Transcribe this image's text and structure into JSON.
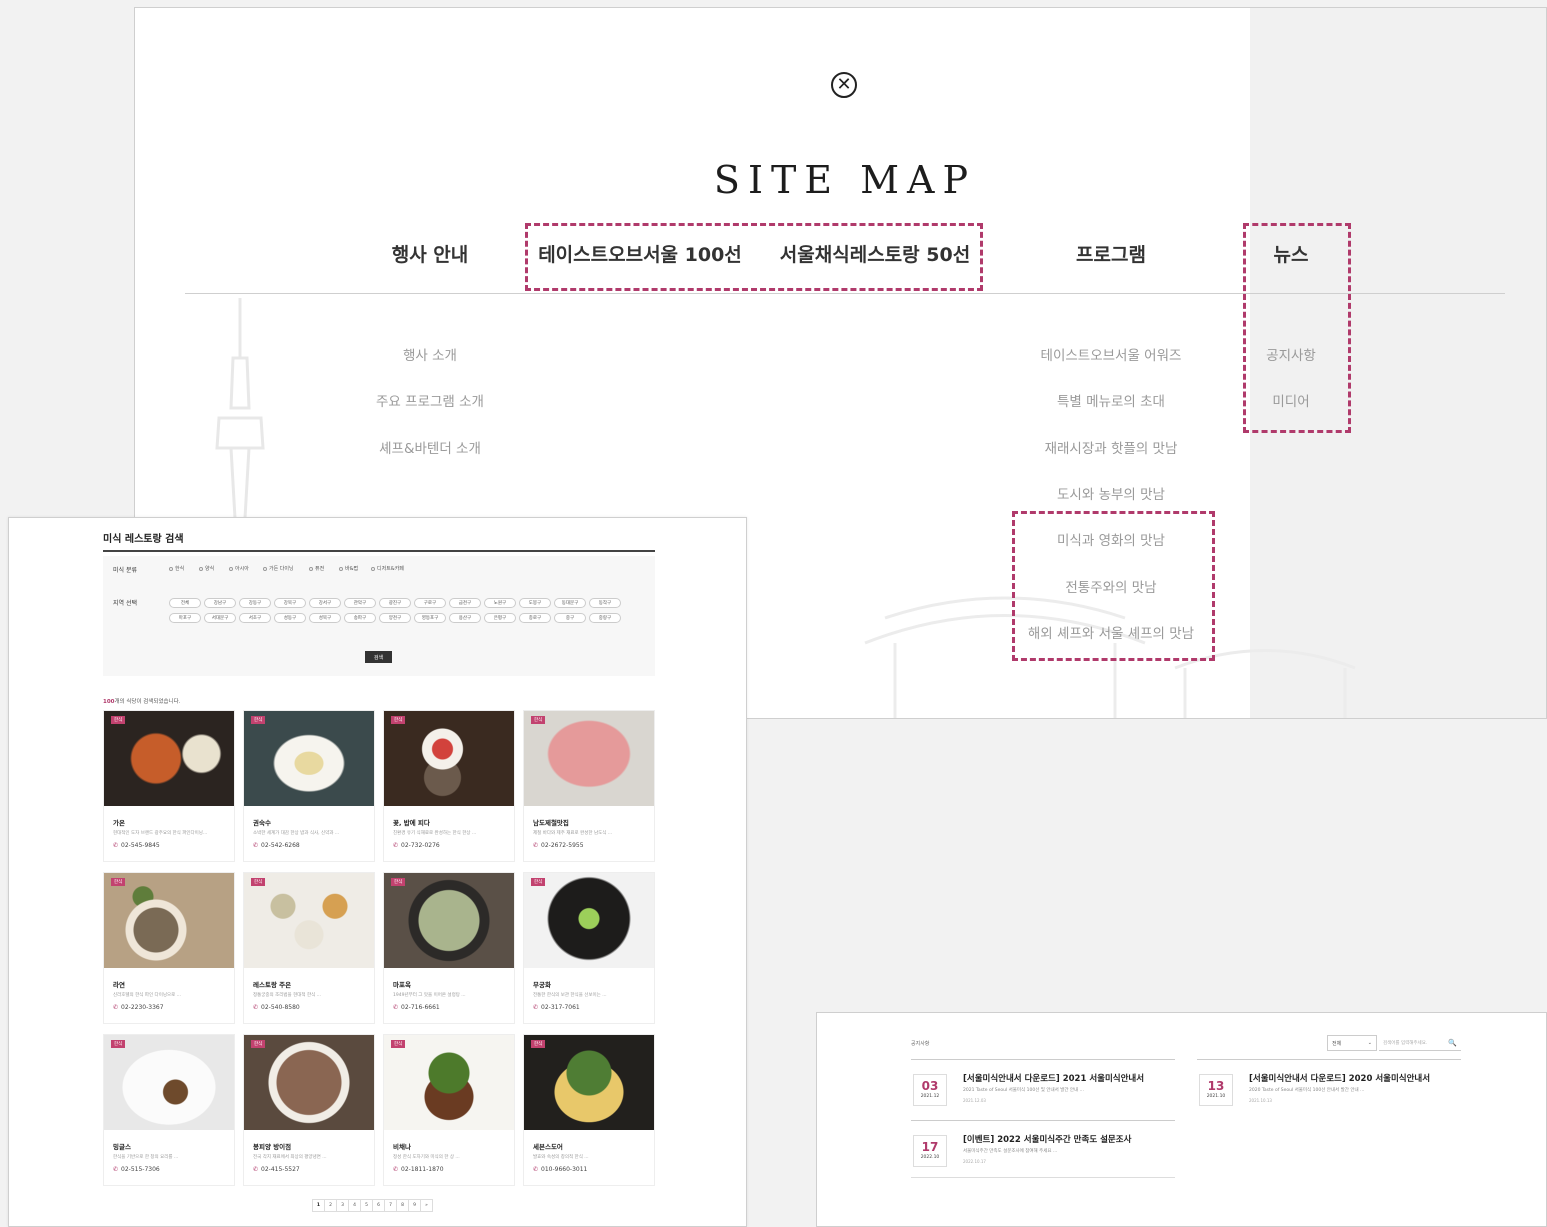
{
  "sitemap": {
    "close_icon": "close-circle-icon",
    "title": "SITE MAP",
    "categories": [
      {
        "label": "행사 안내",
        "items": [
          "행사 소개",
          "주요 프로그램 소개",
          "셰프&바텐더 소개"
        ]
      },
      {
        "label": "테이스트오브서울 100선",
        "items": []
      },
      {
        "label": "서울채식레스토랑 50선",
        "items": []
      },
      {
        "label": "프로그램",
        "items": [
          "테이스트오브서울 어워즈",
          "특별 메뉴로의 초대",
          "재래시장과 핫플의 맛남",
          "도시와 농부의 맛남",
          "미식과 영화의 맛남",
          "전통주와의 맛남",
          "해외 셰프와 서울 셰프의 맛남"
        ]
      },
      {
        "label": "뉴스",
        "items": [
          "공지사항",
          "미디어"
        ]
      }
    ],
    "highlight_color": "#b03a6b"
  },
  "restaurant_search": {
    "title": "미식 레스토랑 검색",
    "cuisine_label": "미식 분류",
    "cuisine_options": [
      "한식",
      "양식",
      "아시아",
      "가든 다이닝",
      "퓨전",
      "바&펍",
      "디저트&카페"
    ],
    "district_label": "지역 선택",
    "districts": [
      "전체",
      "강남구",
      "강동구",
      "강북구",
      "강서구",
      "관악구",
      "광진구",
      "구로구",
      "금천구",
      "노원구",
      "도봉구",
      "동대문구",
      "동작구",
      "마포구",
      "서대문구",
      "서초구",
      "성동구",
      "성북구",
      "송파구",
      "양천구",
      "영등포구",
      "용산구",
      "은평구",
      "종로구",
      "중구",
      "중랑구"
    ],
    "search_button": "검색",
    "result_count_num": "100",
    "result_count_text": "개의 식당이 검색되었습니다.",
    "restaurants": [
      {
        "tag": "한식",
        "name": "가온",
        "desc": "현대적인 도자 브랜드 광주요의 한식 파인다이닝...",
        "phone": "02-545-9845"
      },
      {
        "tag": "한식",
        "name": "권숙수",
        "desc": "소박한 세계가 대감 한상 밥과 식사, 신약과 ...",
        "phone": "02-542-6268"
      },
      {
        "tag": "한식",
        "name": "꽃, 밥에 피다",
        "desc": "친환경 유기 식재료로 완성하는 한식 한상 ...",
        "phone": "02-732-0276"
      },
      {
        "tag": "한식",
        "name": "남도제철맛집",
        "desc": "제철 바다와 제주 재료로 완성한 남도식 ...",
        "phone": "02-2672-5955"
      },
      {
        "tag": "한식",
        "name": "라연",
        "desc": "신라호텔의 한식 파인 다이닝으로 ...",
        "phone": "02-2230-3367"
      },
      {
        "tag": "한식",
        "name": "레스토랑 주은",
        "desc": "정통궁중의 조리법을 현대적 한식 ...",
        "phone": "02-540-8580"
      },
      {
        "tag": "한식",
        "name": "마포옥",
        "desc": "1949년부터 그 맛을 이어온 설렁탕 ...",
        "phone": "02-716-6661"
      },
      {
        "tag": "한식",
        "name": "무궁화",
        "desc": "전통한 한식의 보관 한식을 선보이는 ...",
        "phone": "02-317-7061"
      },
      {
        "tag": "한식",
        "name": "밍글스",
        "desc": "한식을 기반으로 한 창의 요리를 ...",
        "phone": "02-515-7306"
      },
      {
        "tag": "한식",
        "name": "봉피양 방이점",
        "desc": "전국 각지 재료에서 최상의 평양냉면 ...",
        "phone": "02-415-5527"
      },
      {
        "tag": "한식",
        "name": "비채나",
        "desc": "정성 한식 도자기와 미식의 한 상 ...",
        "phone": "02-1811-1870"
      },
      {
        "tag": "한식",
        "name": "세븐스도어",
        "desc": "발효와 숙성의 창의적 한식 ...",
        "phone": "010-9660-3011"
      }
    ],
    "pages": [
      "1",
      "2",
      "3",
      "4",
      "5",
      "6",
      "7",
      "8",
      "9",
      "»"
    ]
  },
  "notice": {
    "breadcrumb": "공지사항",
    "select_value": "전체",
    "search_placeholder": "검색어를 입력해주세요.",
    "search_icon": "search-icon",
    "items": [
      {
        "day": "03",
        "ym": "2021.12",
        "title": "[서울미식안내서 다운로드] 2021 서울미식안내서",
        "body": "2021 Taste of Seoul 서울미식 100선 및 안내서 발간 안내 ...",
        "date": "2021.12.03"
      },
      {
        "day": "13",
        "ym": "2021.10",
        "title": "[서울미식안내서 다운로드] 2020 서울미식안내서",
        "body": "2020 Taste of Seoul 서울미식 100선 안내서 발간 안내 ...",
        "date": "2021.10.13"
      },
      {
        "day": "17",
        "ym": "2022.10",
        "title": "[이벤트] 2022 서울미식주간 만족도 설문조사",
        "body": "서울미식주간 만족도 설문조사에 참여해 주세요 ...",
        "date": "2022.10.17"
      }
    ]
  }
}
